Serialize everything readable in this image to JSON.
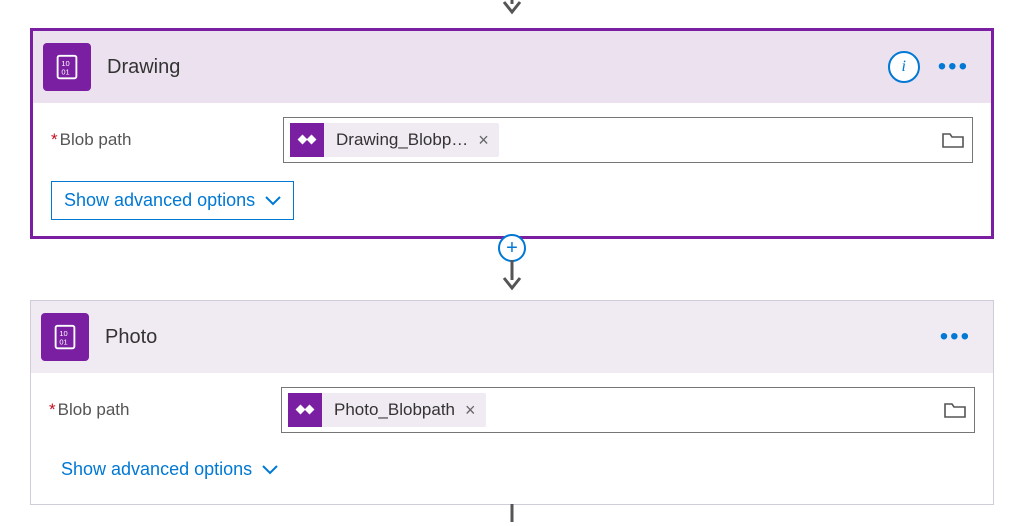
{
  "actions": {
    "drawing": {
      "title": "Drawing",
      "field_label": "Blob path",
      "token_text": "Drawing_Blobp…",
      "advanced_label": "Show advanced options"
    },
    "photo": {
      "title": "Photo",
      "field_label": "Blob path",
      "token_text": "Photo_Blobpath",
      "advanced_label": "Show advanced options"
    }
  },
  "info_glyph": "i",
  "colors": {
    "accent_purple": "#7a1fa2",
    "link_blue": "#0078d4"
  }
}
